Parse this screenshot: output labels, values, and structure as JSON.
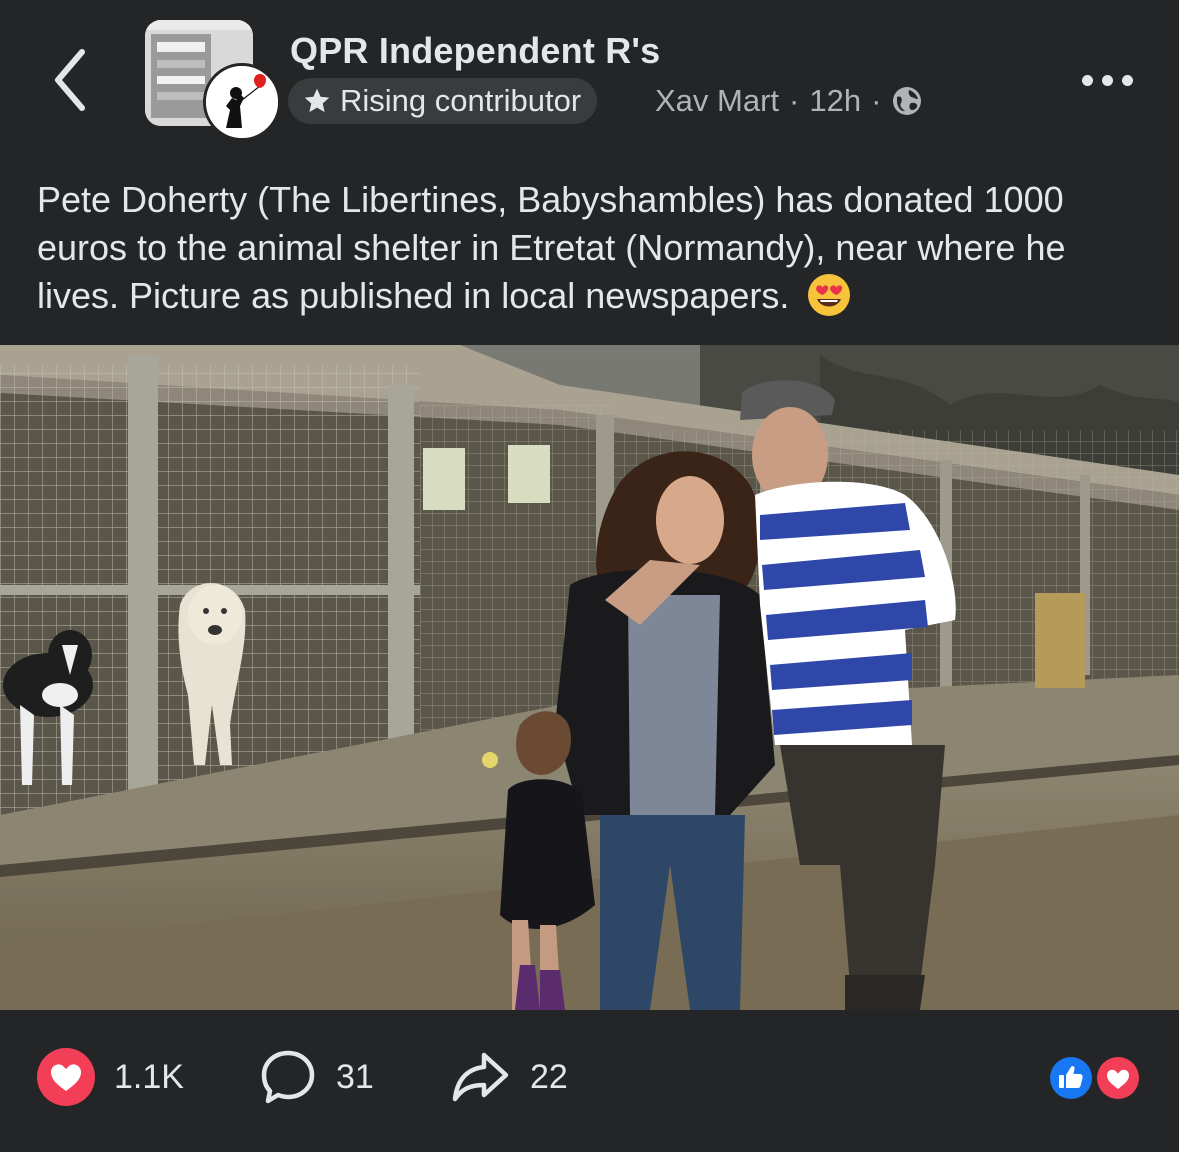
{
  "header": {
    "group_name": "QPR Independent R's",
    "badge_label": "Rising contributor",
    "author": "Xav Mart",
    "separator": "·",
    "time": "12h",
    "icons": {
      "back": "chevron-left-icon",
      "badge": "star-icon",
      "audience": "globe-icon",
      "more": "more-dots-icon"
    }
  },
  "post": {
    "text": "Pete Doherty (The Libertines, Babyshambles) has donated 1000 euros to the animal shelter in Etretat (Normandy), near where he lives. Picture as published in local newspapers.",
    "emoji": "heart-eyes-emoji"
  },
  "footer": {
    "reactions_count": "1.1K",
    "comments_count": "31",
    "shares_count": "22",
    "reaction_icons": [
      "like-icon",
      "love-icon"
    ]
  },
  "colors": {
    "background": "#242526",
    "text_primary": "#e4e6eb",
    "text_secondary": "#b0b3b8",
    "love": "#f33e58",
    "like": "#1877f2",
    "badge_bg": "#3a3b3c"
  }
}
